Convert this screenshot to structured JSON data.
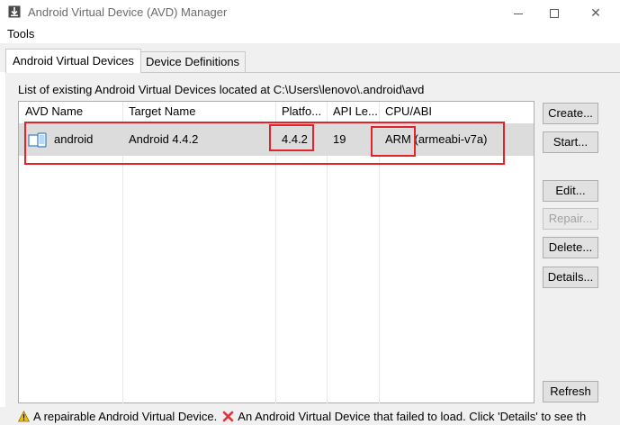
{
  "window": {
    "title": "Android Virtual Device (AVD) Manager",
    "icon": "download-arrow-icon"
  },
  "menu": {
    "tools": "Tools"
  },
  "tabs": [
    {
      "label": "Android Virtual Devices",
      "active": true
    },
    {
      "label": "Device Definitions",
      "active": false
    }
  ],
  "list": {
    "caption": "List of existing Android Virtual Devices located at C:\\Users\\lenovo\\.android\\avd",
    "columns": [
      "AVD Name",
      "Target Name",
      "Platfo...",
      "API Le...",
      "CPU/ABI"
    ],
    "rows": [
      {
        "name": "android",
        "target": "Android 4.4.2",
        "platform": "4.4.2",
        "api": "19",
        "cpu": "ARM (armeabi-v7a)"
      }
    ]
  },
  "buttons": {
    "create": "Create...",
    "start": "Start...",
    "edit": "Edit...",
    "repair": "Repair...",
    "delete": "Delete...",
    "details": "Details...",
    "refresh": "Refresh"
  },
  "status": {
    "warning": "A repairable Android Virtual Device.",
    "error": "An Android Virtual Device that failed to load. Click 'Details' to see th"
  },
  "colors": {
    "highlight": "#e0242a",
    "selected_row": "#dcdcdc",
    "warning": "#f2c200",
    "error": "#d9363e"
  }
}
